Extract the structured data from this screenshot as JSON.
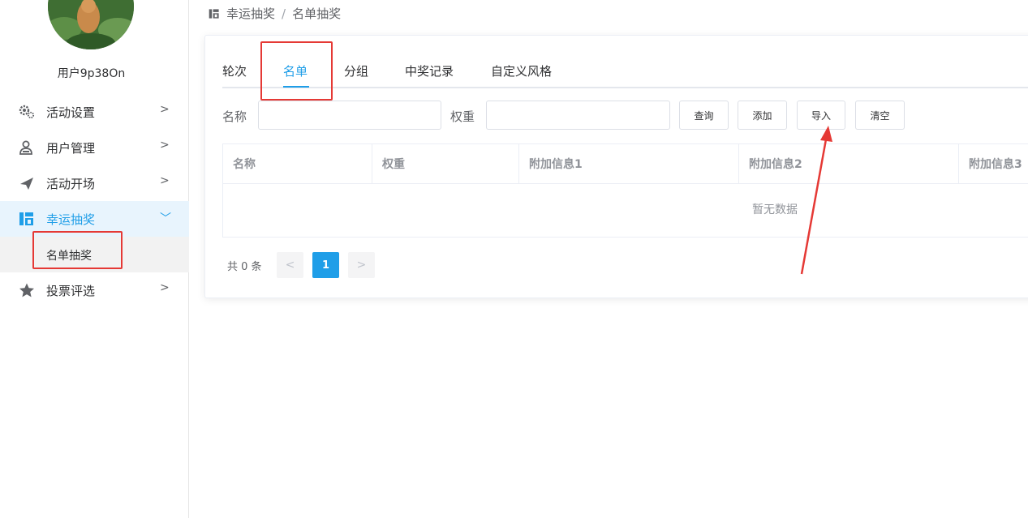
{
  "user": {
    "name": "用户9p38On"
  },
  "sidebar": {
    "items": [
      {
        "label": "活动设置",
        "chevron": ">"
      },
      {
        "label": "用户管理",
        "chevron": ">"
      },
      {
        "label": "活动开场",
        "chevron": ">"
      },
      {
        "label": "幸运抽奖",
        "chevron": "﹀"
      },
      {
        "label": "投票评选",
        "chevron": ">"
      }
    ],
    "submenu": {
      "label": "名单抽奖"
    }
  },
  "breadcrumb": {
    "parent": "幸运抽奖",
    "separator": "/",
    "current": "名单抽奖"
  },
  "tabs": [
    {
      "label": "轮次"
    },
    {
      "label": "名单"
    },
    {
      "label": "分组"
    },
    {
      "label": "中奖记录"
    },
    {
      "label": "自定义风格"
    }
  ],
  "form": {
    "name_label": "名称",
    "name_value": "",
    "weight_label": "权重",
    "weight_value": ""
  },
  "buttons": {
    "query": "查询",
    "add": "添加",
    "import": "导入",
    "clear": "清空"
  },
  "table": {
    "columns": [
      "名称",
      "权重",
      "附加信息1",
      "附加信息2",
      "附加信息3"
    ],
    "rows": [],
    "empty_text": "暂无数据"
  },
  "pagination": {
    "total": "共 0 条",
    "prev": "<",
    "current": "1",
    "next": ">"
  },
  "colors": {
    "accent": "#1f9ee8",
    "annotation": "#e53935"
  },
  "icons": [
    "gear-icon",
    "user-icon",
    "send-icon",
    "gift-icon",
    "star-icon",
    "breadcrumb-gift-icon"
  ]
}
